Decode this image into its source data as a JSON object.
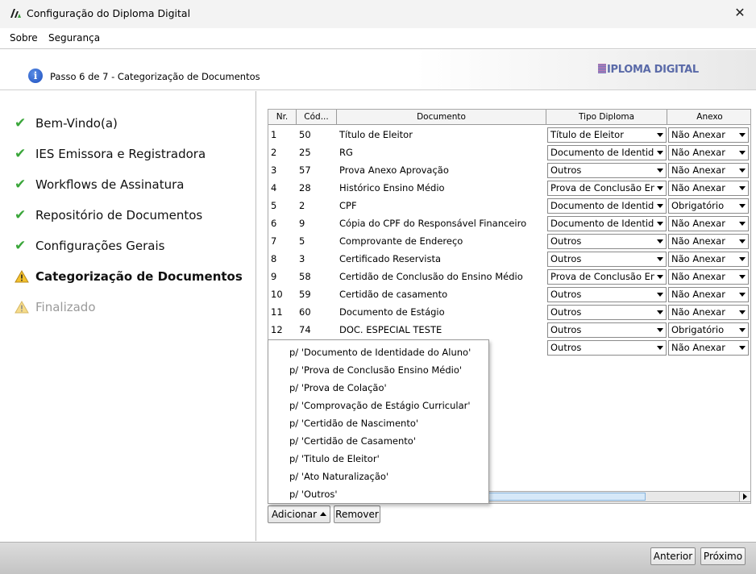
{
  "window": {
    "title": "Configuração do Diploma Digital",
    "close_label": "✕"
  },
  "menu": {
    "items": [
      "Sobre",
      "Segurança"
    ]
  },
  "header": {
    "step_text": "Passo 6 de 7 - Categorização de Documentos",
    "brand": "IPLOMA DIGITAL"
  },
  "sidebar": {
    "steps": [
      {
        "label": "Bem-Vindo(a)",
        "status": "done"
      },
      {
        "label": "IES Emissora e Registradora",
        "status": "done"
      },
      {
        "label": "Workflows de Assinatura",
        "status": "done"
      },
      {
        "label": "Repositório de Documentos",
        "status": "done"
      },
      {
        "label": "Configurações Gerais",
        "status": "done"
      },
      {
        "label": "Categorização de Documentos",
        "status": "current"
      },
      {
        "label": "Finalizado",
        "status": "pending"
      }
    ]
  },
  "table": {
    "headers": [
      "Nr.",
      "Cód...",
      "Documento",
      "Tipo Diploma",
      "Anexo"
    ],
    "rows": [
      {
        "nr": "1",
        "cod": "50",
        "documento": "Título de Eleitor",
        "tipo": "Título de Eleitor",
        "anexo": "Não Anexar"
      },
      {
        "nr": "2",
        "cod": "25",
        "documento": "RG",
        "tipo": "Documento de Identid...",
        "anexo": "Não Anexar"
      },
      {
        "nr": "3",
        "cod": "57",
        "documento": "Prova Anexo Aprovação",
        "tipo": "Outros",
        "anexo": "Não Anexar"
      },
      {
        "nr": "4",
        "cod": "28",
        "documento": "Histórico Ensino Médio",
        "tipo": "Prova de Conclusão En...",
        "anexo": "Não Anexar"
      },
      {
        "nr": "5",
        "cod": "2",
        "documento": "CPF",
        "tipo": "Documento de Identid...",
        "anexo": "Obrigatório"
      },
      {
        "nr": "6",
        "cod": "9",
        "documento": "Cópia do CPF do Responsável Financeiro",
        "tipo": "Documento de Identid...",
        "anexo": "Não Anexar"
      },
      {
        "nr": "7",
        "cod": "5",
        "documento": "Comprovante de Endereço",
        "tipo": "Outros",
        "anexo": "Não Anexar"
      },
      {
        "nr": "8",
        "cod": "3",
        "documento": "Certificado Reservista",
        "tipo": "Outros",
        "anexo": "Não Anexar"
      },
      {
        "nr": "9",
        "cod": "58",
        "documento": "Certidão de Conclusão do Ensino Médio",
        "tipo": "Prova de Conclusão En...",
        "anexo": "Não Anexar"
      },
      {
        "nr": "10",
        "cod": "59",
        "documento": "Certidão de casamento",
        "tipo": "Outros",
        "anexo": "Não Anexar"
      },
      {
        "nr": "11",
        "cod": "60",
        "documento": "Documento de Estágio",
        "tipo": "Outros",
        "anexo": "Não Anexar"
      },
      {
        "nr": "12",
        "cod": "74",
        "documento": "DOC. ESPECIAL TESTE",
        "tipo": "Outros",
        "anexo": "Obrigatório"
      },
      {
        "nr": "",
        "cod": "",
        "documento": "",
        "tipo": "Outros",
        "anexo": "Não Anexar"
      }
    ]
  },
  "popup_menu": {
    "items": [
      "p/ 'Documento de Identidade do Aluno'",
      "p/ 'Prova de Conclusão Ensino Médio'",
      "p/ 'Prova de Colação'",
      "p/ 'Comprovação de Estágio Curricular'",
      "p/ 'Certidão de Nascimento'",
      "p/ 'Certidão de Casamento'",
      "p/ 'Titulo de Eleitor'",
      "p/ 'Ato Naturalização'",
      "p/ 'Outros'"
    ]
  },
  "buttons": {
    "add": "Adicionar",
    "remove": "Remover",
    "previous": "Anterior",
    "next": "Próximo"
  }
}
